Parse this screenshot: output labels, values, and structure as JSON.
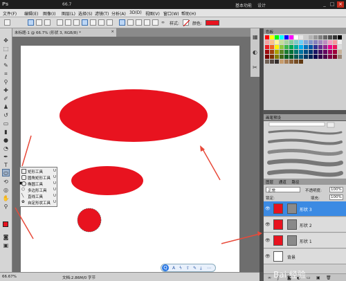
{
  "app": {
    "logo": "Ps",
    "zoom_display": "66.7",
    "workspace_basic": "基本功能",
    "workspace_design": "设计",
    "minimize": "_",
    "restore": "□",
    "close": "×"
  },
  "menu": [
    "文件(F)",
    "编辑(E)",
    "图像(I)",
    "图层(L)",
    "选择(S)",
    "滤镜(T)",
    "分析(A)",
    "3D(D)",
    "视图(V)",
    "窗口(W)",
    "帮助(H)"
  ],
  "options": {
    "style_label": "样式:",
    "color_label": "颜色:",
    "color": "#e8131f"
  },
  "document": {
    "tab_title": "未标题-1 @ 66.7% (形状 3, RGB/8) *",
    "tab_close": "×"
  },
  "tool_flyout": {
    "items": [
      {
        "label": "矩形工具",
        "key": "U",
        "marker": ""
      },
      {
        "label": "圆角矩形工具",
        "key": "U",
        "marker": ""
      },
      {
        "label": "椭圆工具",
        "key": "U",
        "marker": "■"
      },
      {
        "label": "多边形工具",
        "key": "U",
        "marker": ""
      },
      {
        "label": "直线工具",
        "key": "U",
        "marker": ""
      },
      {
        "label": "自定形状工具",
        "key": "U",
        "marker": ""
      }
    ]
  },
  "panels": {
    "swatches_tab": "色板",
    "brush_tab": "画笔预设",
    "layers_tab": "图层",
    "channels_tab": "通道",
    "paths_tab": "路径",
    "blend_mode": "正常",
    "opacity_label": "不透明度:",
    "opacity_value": "100%",
    "fill_label": "填充:",
    "fill_value": "100%",
    "lock_label": "锁定:"
  },
  "layers": [
    {
      "name": "形状 3",
      "active": true
    },
    {
      "name": "形状 2",
      "active": false
    },
    {
      "name": "形状 1",
      "active": false
    },
    {
      "name": "背景",
      "active": false
    }
  ],
  "status": {
    "zoom": "66.67%",
    "doc_info": "文档:2.86M/0 字节"
  },
  "watermark": "Bai 经验",
  "colors": {
    "shape_red": "#e8131f",
    "arrow_red": "#e84a3a",
    "layer_active": "#3b8ae3"
  }
}
